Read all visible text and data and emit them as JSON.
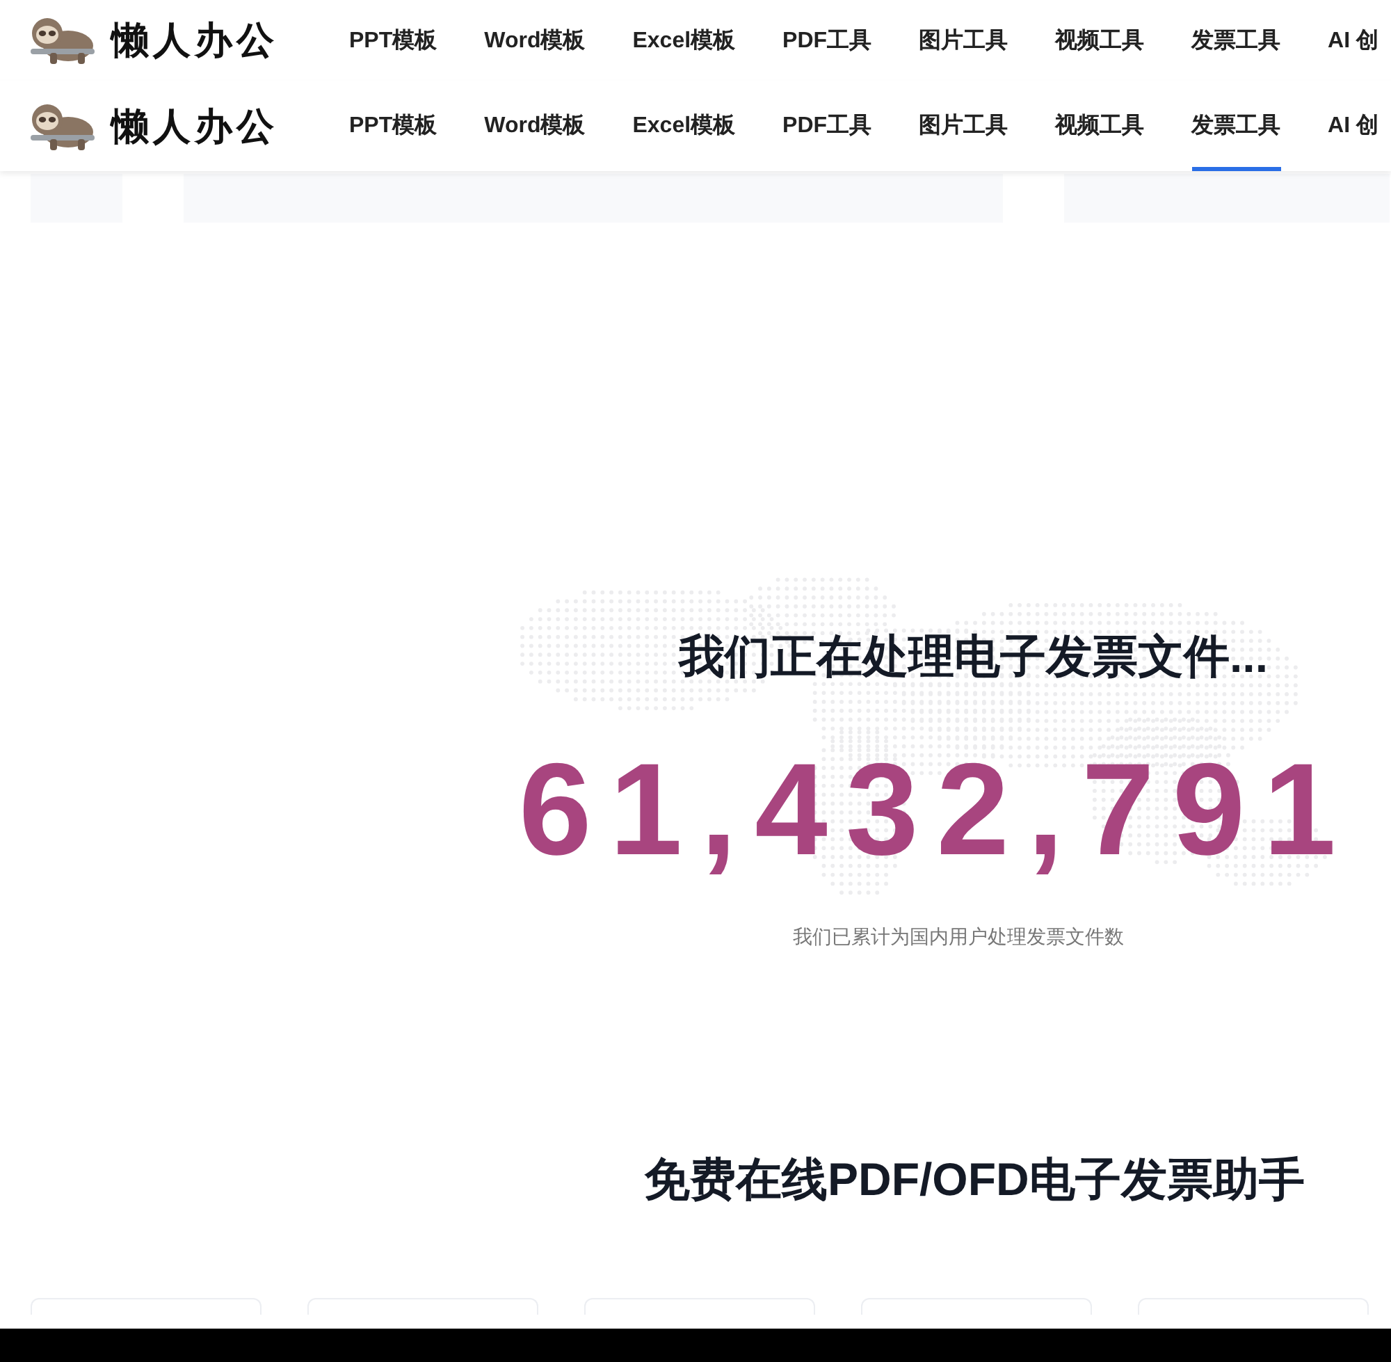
{
  "headers": [
    {
      "logo": "懒人办公",
      "nav": [
        {
          "label": "PPT模板",
          "selected": false
        },
        {
          "label": "Word模板",
          "selected": false
        },
        {
          "label": "Excel模板",
          "selected": false
        },
        {
          "label": "PDF工具",
          "selected": false
        },
        {
          "label": "图片工具",
          "selected": false
        },
        {
          "label": "视频工具",
          "selected": false
        },
        {
          "label": "发票工具",
          "selected": false
        },
        {
          "label": "AI 创",
          "selected": false
        }
      ]
    },
    {
      "logo": "懒人办公",
      "nav": [
        {
          "label": "PPT模板",
          "selected": false
        },
        {
          "label": "Word模板",
          "selected": false
        },
        {
          "label": "Excel模板",
          "selected": false
        },
        {
          "label": "PDF工具",
          "selected": false
        },
        {
          "label": "图片工具",
          "selected": false
        },
        {
          "label": "视频工具",
          "selected": false
        },
        {
          "label": "发票工具",
          "selected": true
        },
        {
          "label": "AI 创",
          "selected": false
        }
      ]
    }
  ],
  "stats": {
    "title": "我们正在处理电子发票文件...",
    "count": "61,432,791",
    "caption": "我们已累计为国内用户处理发票文件数"
  },
  "tools": {
    "heading": "免费在线PDF/OFD电子发票助手"
  }
}
